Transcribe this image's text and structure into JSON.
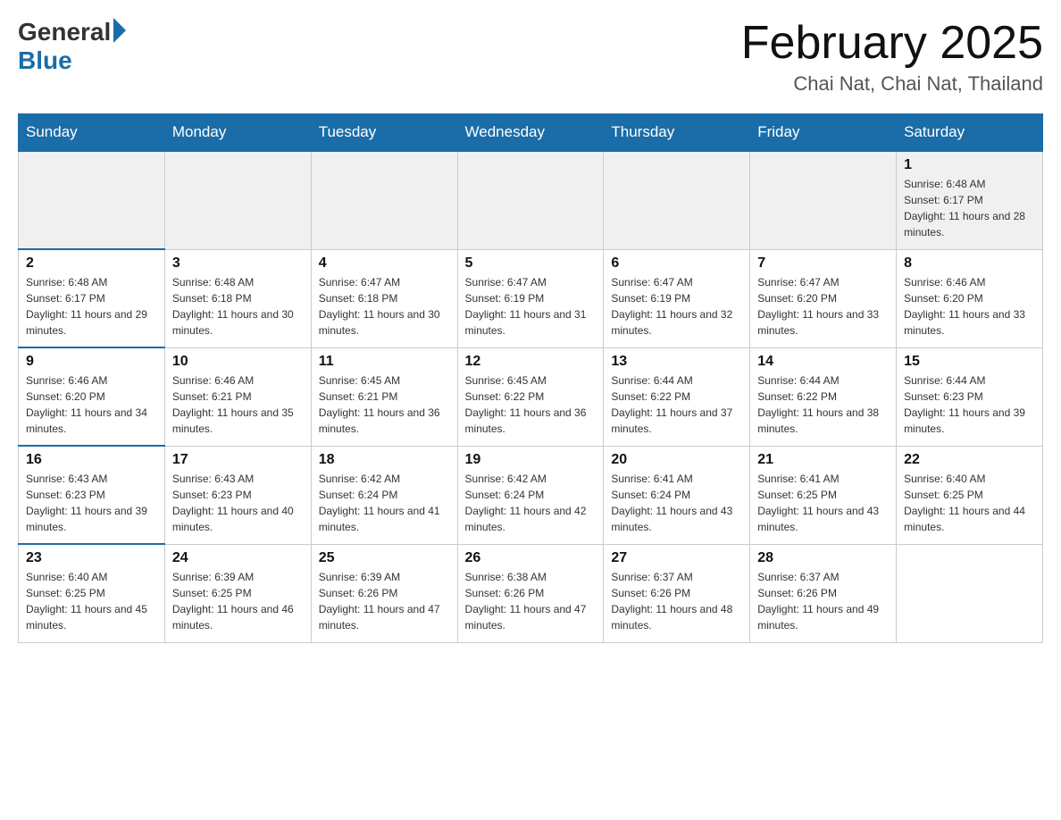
{
  "header": {
    "logo_general": "General",
    "logo_blue": "Blue",
    "month_title": "February 2025",
    "location": "Chai Nat, Chai Nat, Thailand"
  },
  "days_of_week": [
    "Sunday",
    "Monday",
    "Tuesday",
    "Wednesday",
    "Thursday",
    "Friday",
    "Saturday"
  ],
  "weeks": [
    [
      {
        "day": "",
        "sunrise": "",
        "sunset": "",
        "daylight": ""
      },
      {
        "day": "",
        "sunrise": "",
        "sunset": "",
        "daylight": ""
      },
      {
        "day": "",
        "sunrise": "",
        "sunset": "",
        "daylight": ""
      },
      {
        "day": "",
        "sunrise": "",
        "sunset": "",
        "daylight": ""
      },
      {
        "day": "",
        "sunrise": "",
        "sunset": "",
        "daylight": ""
      },
      {
        "day": "",
        "sunrise": "",
        "sunset": "",
        "daylight": ""
      },
      {
        "day": "1",
        "sunrise": "Sunrise: 6:48 AM",
        "sunset": "Sunset: 6:17 PM",
        "daylight": "Daylight: 11 hours and 28 minutes."
      }
    ],
    [
      {
        "day": "2",
        "sunrise": "Sunrise: 6:48 AM",
        "sunset": "Sunset: 6:17 PM",
        "daylight": "Daylight: 11 hours and 29 minutes."
      },
      {
        "day": "3",
        "sunrise": "Sunrise: 6:48 AM",
        "sunset": "Sunset: 6:18 PM",
        "daylight": "Daylight: 11 hours and 30 minutes."
      },
      {
        "day": "4",
        "sunrise": "Sunrise: 6:47 AM",
        "sunset": "Sunset: 6:18 PM",
        "daylight": "Daylight: 11 hours and 30 minutes."
      },
      {
        "day": "5",
        "sunrise": "Sunrise: 6:47 AM",
        "sunset": "Sunset: 6:19 PM",
        "daylight": "Daylight: 11 hours and 31 minutes."
      },
      {
        "day": "6",
        "sunrise": "Sunrise: 6:47 AM",
        "sunset": "Sunset: 6:19 PM",
        "daylight": "Daylight: 11 hours and 32 minutes."
      },
      {
        "day": "7",
        "sunrise": "Sunrise: 6:47 AM",
        "sunset": "Sunset: 6:20 PM",
        "daylight": "Daylight: 11 hours and 33 minutes."
      },
      {
        "day": "8",
        "sunrise": "Sunrise: 6:46 AM",
        "sunset": "Sunset: 6:20 PM",
        "daylight": "Daylight: 11 hours and 33 minutes."
      }
    ],
    [
      {
        "day": "9",
        "sunrise": "Sunrise: 6:46 AM",
        "sunset": "Sunset: 6:20 PM",
        "daylight": "Daylight: 11 hours and 34 minutes."
      },
      {
        "day": "10",
        "sunrise": "Sunrise: 6:46 AM",
        "sunset": "Sunset: 6:21 PM",
        "daylight": "Daylight: 11 hours and 35 minutes."
      },
      {
        "day": "11",
        "sunrise": "Sunrise: 6:45 AM",
        "sunset": "Sunset: 6:21 PM",
        "daylight": "Daylight: 11 hours and 36 minutes."
      },
      {
        "day": "12",
        "sunrise": "Sunrise: 6:45 AM",
        "sunset": "Sunset: 6:22 PM",
        "daylight": "Daylight: 11 hours and 36 minutes."
      },
      {
        "day": "13",
        "sunrise": "Sunrise: 6:44 AM",
        "sunset": "Sunset: 6:22 PM",
        "daylight": "Daylight: 11 hours and 37 minutes."
      },
      {
        "day": "14",
        "sunrise": "Sunrise: 6:44 AM",
        "sunset": "Sunset: 6:22 PM",
        "daylight": "Daylight: 11 hours and 38 minutes."
      },
      {
        "day": "15",
        "sunrise": "Sunrise: 6:44 AM",
        "sunset": "Sunset: 6:23 PM",
        "daylight": "Daylight: 11 hours and 39 minutes."
      }
    ],
    [
      {
        "day": "16",
        "sunrise": "Sunrise: 6:43 AM",
        "sunset": "Sunset: 6:23 PM",
        "daylight": "Daylight: 11 hours and 39 minutes."
      },
      {
        "day": "17",
        "sunrise": "Sunrise: 6:43 AM",
        "sunset": "Sunset: 6:23 PM",
        "daylight": "Daylight: 11 hours and 40 minutes."
      },
      {
        "day": "18",
        "sunrise": "Sunrise: 6:42 AM",
        "sunset": "Sunset: 6:24 PM",
        "daylight": "Daylight: 11 hours and 41 minutes."
      },
      {
        "day": "19",
        "sunrise": "Sunrise: 6:42 AM",
        "sunset": "Sunset: 6:24 PM",
        "daylight": "Daylight: 11 hours and 42 minutes."
      },
      {
        "day": "20",
        "sunrise": "Sunrise: 6:41 AM",
        "sunset": "Sunset: 6:24 PM",
        "daylight": "Daylight: 11 hours and 43 minutes."
      },
      {
        "day": "21",
        "sunrise": "Sunrise: 6:41 AM",
        "sunset": "Sunset: 6:25 PM",
        "daylight": "Daylight: 11 hours and 43 minutes."
      },
      {
        "day": "22",
        "sunrise": "Sunrise: 6:40 AM",
        "sunset": "Sunset: 6:25 PM",
        "daylight": "Daylight: 11 hours and 44 minutes."
      }
    ],
    [
      {
        "day": "23",
        "sunrise": "Sunrise: 6:40 AM",
        "sunset": "Sunset: 6:25 PM",
        "daylight": "Daylight: 11 hours and 45 minutes."
      },
      {
        "day": "24",
        "sunrise": "Sunrise: 6:39 AM",
        "sunset": "Sunset: 6:25 PM",
        "daylight": "Daylight: 11 hours and 46 minutes."
      },
      {
        "day": "25",
        "sunrise": "Sunrise: 6:39 AM",
        "sunset": "Sunset: 6:26 PM",
        "daylight": "Daylight: 11 hours and 47 minutes."
      },
      {
        "day": "26",
        "sunrise": "Sunrise: 6:38 AM",
        "sunset": "Sunset: 6:26 PM",
        "daylight": "Daylight: 11 hours and 47 minutes."
      },
      {
        "day": "27",
        "sunrise": "Sunrise: 6:37 AM",
        "sunset": "Sunset: 6:26 PM",
        "daylight": "Daylight: 11 hours and 48 minutes."
      },
      {
        "day": "28",
        "sunrise": "Sunrise: 6:37 AM",
        "sunset": "Sunset: 6:26 PM",
        "daylight": "Daylight: 11 hours and 49 minutes."
      },
      {
        "day": "",
        "sunrise": "",
        "sunset": "",
        "daylight": ""
      }
    ]
  ]
}
